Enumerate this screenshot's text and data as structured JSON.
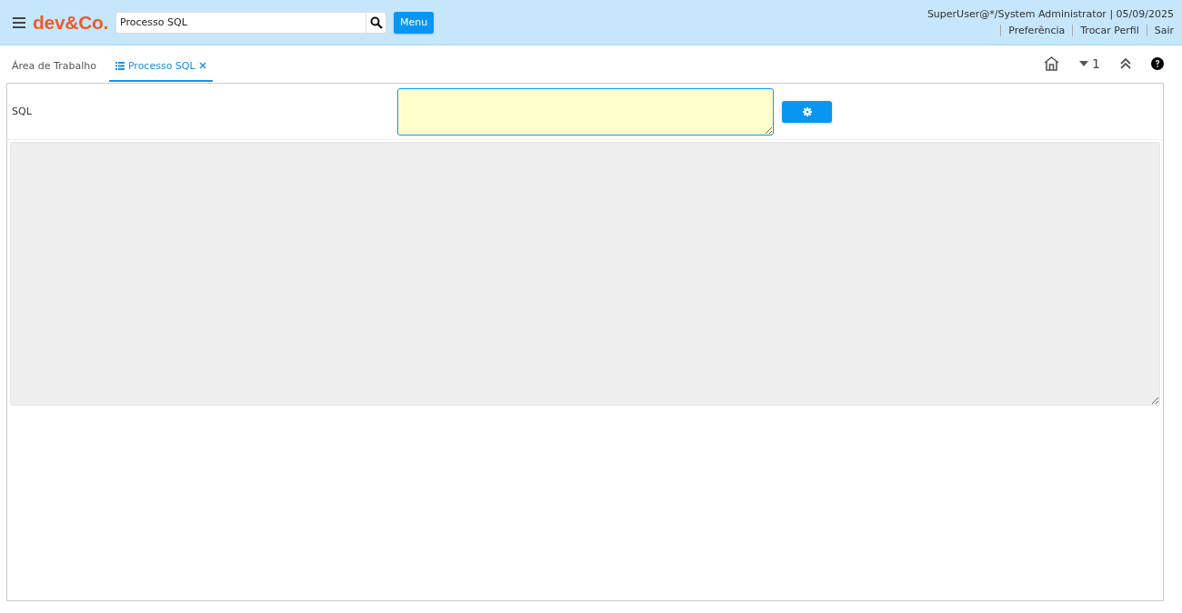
{
  "header": {
    "logo": "dev&Co.",
    "search": {
      "value": "Processo SQL"
    },
    "menu_button": "Menu",
    "user_info": "SuperUser@*/System Administrator | 05/09/2025",
    "links": [
      "Preferência",
      "Trocar Perfil",
      "Sair"
    ]
  },
  "tabs": [
    {
      "label": "Área de Trabalho",
      "selected": false,
      "closable": false
    },
    {
      "label": "Processo SQL",
      "selected": true,
      "closable": true
    }
  ],
  "toolbar": {
    "count": "1"
  },
  "form": {
    "sql_label": "SQL"
  }
}
